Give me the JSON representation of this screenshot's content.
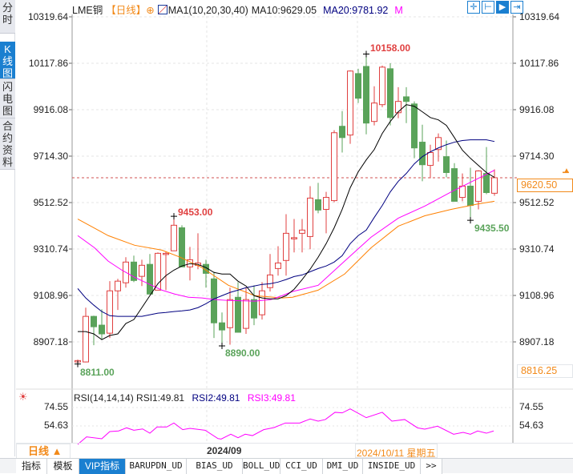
{
  "sidebar": {
    "tabs": [
      {
        "label": "分时"
      },
      {
        "label": "K线图",
        "active": true
      },
      {
        "label": "闪电图"
      },
      {
        "label": "合约资料"
      }
    ]
  },
  "header": {
    "symbol": "LME铜",
    "period": "【日线】",
    "add_icon": "⊕",
    "ma_params": "MA1(10,20,30,40)",
    "ma10": "MA10:9629.05",
    "ma20": "MA20:9781.92",
    "ma30_truncated": "M"
  },
  "toolbar": {
    "icons": [
      "crosshair-icon",
      "range-icon",
      "play-range-icon",
      "exit-icon"
    ]
  },
  "price_axis": {
    "labels": [
      "10319.64",
      "10117.86",
      "9916.08",
      "9714.30",
      "9512.52",
      "9310.74",
      "9108.96",
      "8907.18"
    ],
    "current_price": "9620.50",
    "min_price": "8816.25",
    "max": 10319.64,
    "min": 8907.18
  },
  "annotations": {
    "high": "10158.00",
    "local_high": "9453.00",
    "low": "8811.00",
    "local_low": "8890.00",
    "recent_low": "9435.50"
  },
  "colors": {
    "up": "#e04040",
    "down": "#5aa35a",
    "ma10": "#000000",
    "ma20": "#000080",
    "ma30": "#ff00ff",
    "ma40": "#ff8000",
    "accent": "#1a7fd0",
    "orange": "#f28a1a"
  },
  "chart_data": {
    "type": "candlestick",
    "candles": [
      [
        8820,
        8830,
        8811,
        8826
      ],
      [
        8820,
        9056,
        8818,
        9018
      ],
      [
        9018,
        9021,
        8893,
        8973
      ],
      [
        8980,
        9049,
        8917,
        8942
      ],
      [
        8945,
        9171,
        8924,
        9129
      ],
      [
        9129,
        9181,
        9046,
        9171
      ],
      [
        9164,
        9275,
        9143,
        9254
      ],
      [
        9254,
        9282,
        9167,
        9174
      ],
      [
        9192,
        9264,
        9150,
        9240
      ],
      [
        9244,
        9289,
        9115,
        9115
      ],
      [
        9132,
        9296,
        9132,
        9292
      ],
      [
        9290,
        9299,
        9132,
        9292
      ],
      [
        9303,
        9453,
        9303,
        9414
      ],
      [
        9403,
        9414,
        9233,
        9233
      ],
      [
        9233,
        9320,
        9174,
        9264
      ],
      [
        9240,
        9379,
        9223,
        9250
      ],
      [
        9244,
        9264,
        9143,
        9205
      ],
      [
        9181,
        9212,
        8924,
        8990
      ],
      [
        8990,
        9035,
        8890,
        8959
      ],
      [
        8969,
        9143,
        8895,
        9091
      ],
      [
        9101,
        9167,
        8949,
        8949
      ],
      [
        8966,
        9143,
        8942,
        9091
      ],
      [
        9091,
        9153,
        8980,
        9011
      ],
      [
        9025,
        9167,
        9004,
        9129
      ],
      [
        9143,
        9289,
        9126,
        9198
      ],
      [
        9226,
        9323,
        9195,
        9250
      ],
      [
        9261,
        9462,
        9195,
        9379
      ],
      [
        9356,
        9441,
        9296,
        9360
      ],
      [
        9379,
        9441,
        9296,
        9393
      ],
      [
        9365,
        9584,
        9310,
        9532
      ],
      [
        9525,
        9598,
        9466,
        9480
      ],
      [
        9483,
        9559,
        9379,
        9535
      ],
      [
        9521,
        9827,
        9514,
        9816
      ],
      [
        9844,
        9910,
        9730,
        9795
      ],
      [
        9806,
        10087,
        9768,
        10084
      ],
      [
        10073,
        10094,
        9945,
        9966
      ],
      [
        10104,
        10158,
        9809,
        9858
      ],
      [
        9865,
        10018,
        9848,
        9945
      ],
      [
        9938,
        10108,
        9927,
        10101
      ],
      [
        10094,
        10118,
        9848,
        9882
      ],
      [
        9903,
        10014,
        9879,
        9952
      ],
      [
        9972,
        10014,
        9858,
        9952
      ],
      [
        9941,
        9952,
        9705,
        9750
      ],
      [
        9775,
        9851,
        9605,
        9677
      ],
      [
        9674,
        9764,
        9618,
        9730
      ],
      [
        9743,
        9813,
        9691,
        9795
      ],
      [
        9712,
        9782,
        9622,
        9643
      ],
      [
        9660,
        9684,
        9518,
        9518
      ],
      [
        9535,
        9639,
        9518,
        9584
      ],
      [
        9584,
        9664,
        9435.5,
        9500
      ],
      [
        9518,
        9653,
        9483,
        9650
      ],
      [
        9639,
        9754,
        9549,
        9556
      ],
      [
        9553,
        9657,
        9542,
        9620.5
      ]
    ],
    "ma10": [
      8952,
      8952,
      8942,
      8917,
      8935,
      8942,
      8987,
      9004,
      9056,
      9108,
      9160,
      9195,
      9219,
      9237,
      9247,
      9244,
      9230,
      9209,
      9202,
      9202,
      9171,
      9150,
      9108,
      9098,
      9094,
      9094,
      9108,
      9136,
      9178,
      9223,
      9275,
      9334,
      9403,
      9483,
      9577,
      9646,
      9698,
      9743,
      9813,
      9865,
      9907,
      9938,
      9931,
      9907,
      9882,
      9872,
      9848,
      9795,
      9740,
      9705,
      9674,
      9643,
      9622
    ],
    "ma20": [
      9139,
      9098,
      9067,
      9039,
      9021,
      9018,
      9018,
      9018,
      9018,
      9025,
      9032,
      9035,
      9039,
      9042,
      9046,
      9056,
      9073,
      9094,
      9108,
      9122,
      9132,
      9143,
      9150,
      9157,
      9160,
      9167,
      9178,
      9191,
      9198,
      9212,
      9226,
      9237,
      9254,
      9282,
      9334,
      9369,
      9393,
      9448,
      9500,
      9559,
      9605,
      9639,
      9681,
      9712,
      9733,
      9750,
      9764,
      9775,
      9782,
      9785,
      9785,
      9785,
      9778
    ],
    "ma30": [
      [
        1,
        9369
      ],
      [
        3.1,
        9316
      ],
      [
        4.8,
        9258
      ],
      [
        6.5,
        9219
      ],
      [
        8.1,
        9188
      ],
      [
        9.8,
        9160
      ],
      [
        11.5,
        9132
      ],
      [
        13.1,
        9115
      ],
      [
        14.8,
        9101
      ],
      [
        16.5,
        9098
      ],
      [
        18.1,
        9091
      ],
      [
        19.8,
        9087
      ],
      [
        23.1,
        9084
      ],
      [
        25.1,
        9091
      ],
      [
        26.5,
        9108
      ],
      [
        27.8,
        9126
      ],
      [
        31,
        9153
      ],
      [
        34.3,
        9258
      ],
      [
        37.6,
        9362
      ],
      [
        41,
        9445
      ],
      [
        44.3,
        9497
      ],
      [
        47.6,
        9559
      ],
      [
        51,
        9618
      ],
      [
        53,
        9653
      ]
    ],
    "ma40": [
      [
        1,
        9441
      ],
      [
        4.8,
        9369
      ],
      [
        8.1,
        9327
      ],
      [
        11.5,
        9306
      ],
      [
        13.8,
        9275
      ],
      [
        16.5,
        9230
      ],
      [
        19.8,
        9153
      ],
      [
        23.1,
        9108
      ],
      [
        26.5,
        9098
      ],
      [
        27.8,
        9101
      ],
      [
        31,
        9132
      ],
      [
        34.3,
        9202
      ],
      [
        37.6,
        9316
      ],
      [
        41,
        9410
      ],
      [
        44.3,
        9455
      ],
      [
        47.6,
        9483
      ],
      [
        51,
        9507
      ],
      [
        53,
        9518
      ]
    ],
    "x_labels": [
      "2024/09"
    ],
    "rsi": {
      "labels": [
        "74.55",
        "54.63"
      ],
      "values": [
        [
          1,
          34.7
        ],
        [
          2.1,
          42.8
        ],
        [
          4,
          40.8
        ],
        [
          5,
          48.6
        ],
        [
          6.1,
          49.2
        ],
        [
          7.1,
          52.6
        ],
        [
          8,
          50.0
        ],
        [
          9.1,
          51.4
        ],
        [
          10,
          46.8
        ],
        [
          10.9,
          53.5
        ],
        [
          12.1,
          53.5
        ],
        [
          13,
          57.8
        ],
        [
          14.1,
          50.6
        ],
        [
          15,
          52.0
        ],
        [
          16.9,
          50.0
        ],
        [
          18.5,
          41.0
        ],
        [
          18.9,
          40.5
        ],
        [
          20.1,
          45.7
        ],
        [
          21,
          41.9
        ],
        [
          21.9,
          45.7
        ],
        [
          22.8,
          44.2
        ],
        [
          24.2,
          50.6
        ],
        [
          25.5,
          52.9
        ],
        [
          26.9,
          57.8
        ],
        [
          28.7,
          57.8
        ],
        [
          30,
          62.2
        ],
        [
          31,
          59.8
        ],
        [
          31.9,
          61.6
        ],
        [
          33.1,
          69.4
        ],
        [
          34,
          68.8
        ],
        [
          35,
          73.1
        ],
        [
          37,
          63.6
        ],
        [
          39,
          69.4
        ],
        [
          40.2,
          59.8
        ],
        [
          41.8,
          61.6
        ],
        [
          43.4,
          52.6
        ],
        [
          44.3,
          51.2
        ],
        [
          45.9,
          54.4
        ],
        [
          47.9,
          45.7
        ],
        [
          49.1,
          47.7
        ],
        [
          50,
          45.7
        ],
        [
          50.9,
          49.2
        ],
        [
          52,
          46.8
        ],
        [
          52.9,
          49.2
        ]
      ]
    }
  },
  "rsi_panel": {
    "params": "RSI(14,14,14) RSI1:49.81",
    "rsi2": "RSI2:49.81",
    "rsi3": "RSI3:49.81",
    "labels": [
      "74.55",
      "54.63"
    ]
  },
  "datebar": {
    "period": "日线 ▲",
    "month": "2024/09",
    "cursor_date": "2024/10/11 星期五"
  },
  "tabs": [
    {
      "label": "指标"
    },
    {
      "label": "模板"
    },
    {
      "label": "VIP指标",
      "active": true
    },
    {
      "label": "BARUPDN_UD"
    },
    {
      "label": "BIAS_UD"
    },
    {
      "label": "BOLL_UD"
    },
    {
      "label": "CCI_UD"
    },
    {
      "label": "DMI_UD"
    },
    {
      "label": "INSIDE_UD"
    },
    {
      "label": ">>"
    }
  ]
}
